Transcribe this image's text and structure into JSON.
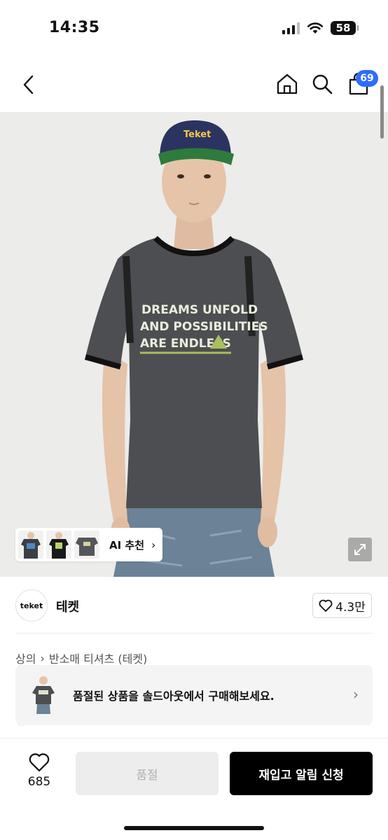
{
  "status_bar": {
    "time": "14:35",
    "battery": "58"
  },
  "nav": {
    "cart_count": "69",
    "icons": [
      "back-chevron-icon",
      "home-icon",
      "search-icon",
      "shopping-bag-icon"
    ]
  },
  "product_image": {
    "shirt_text_lines": [
      "DREAMS UNFOLD",
      "AND POSSIBILITIES",
      "ARE ENDLESS"
    ],
    "cap_logo": "Teket"
  },
  "gallery": {
    "ai_label": "AI 추천"
  },
  "brand": {
    "logo_text": "teket",
    "name": "테켓",
    "likes": "4.3만"
  },
  "breadcrumb": {
    "category": "상의",
    "subcategory": "반소매 티셔츠 (테켓)"
  },
  "soldout_banner": {
    "text": "품절된 상품을 솔드아웃에서 구매해보세요."
  },
  "bottom_bar": {
    "wish_count": "685",
    "soldout_label": "품절",
    "restock_label": "재입고 알림 신청"
  },
  "colors": {
    "accent_blue": "#2f6bff",
    "primary_button": "#000000",
    "disabled_button": "#ededed",
    "background_image": "#ececea"
  }
}
